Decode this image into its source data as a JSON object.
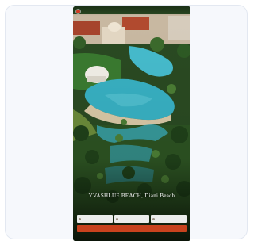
{
  "nav": {
    "links": [
      "",
      ""
    ]
  },
  "hero": {
    "title": "YVASHLUE BEACH, Diani Beach",
    "subtitle": ""
  },
  "booking": {
    "label": "",
    "fields": [
      {
        "icon": "calendar-icon",
        "value": ""
      },
      {
        "icon": "calendar-icon",
        "value": ""
      },
      {
        "icon": "guests-icon",
        "value": ""
      }
    ],
    "button_label": ""
  },
  "colors": {
    "accent": "#c8421e",
    "pool": "#3fb2c4",
    "lawn": "#2f6b2a",
    "card_bg": "#f6f8fc",
    "card_border": "#e3e8f1"
  }
}
